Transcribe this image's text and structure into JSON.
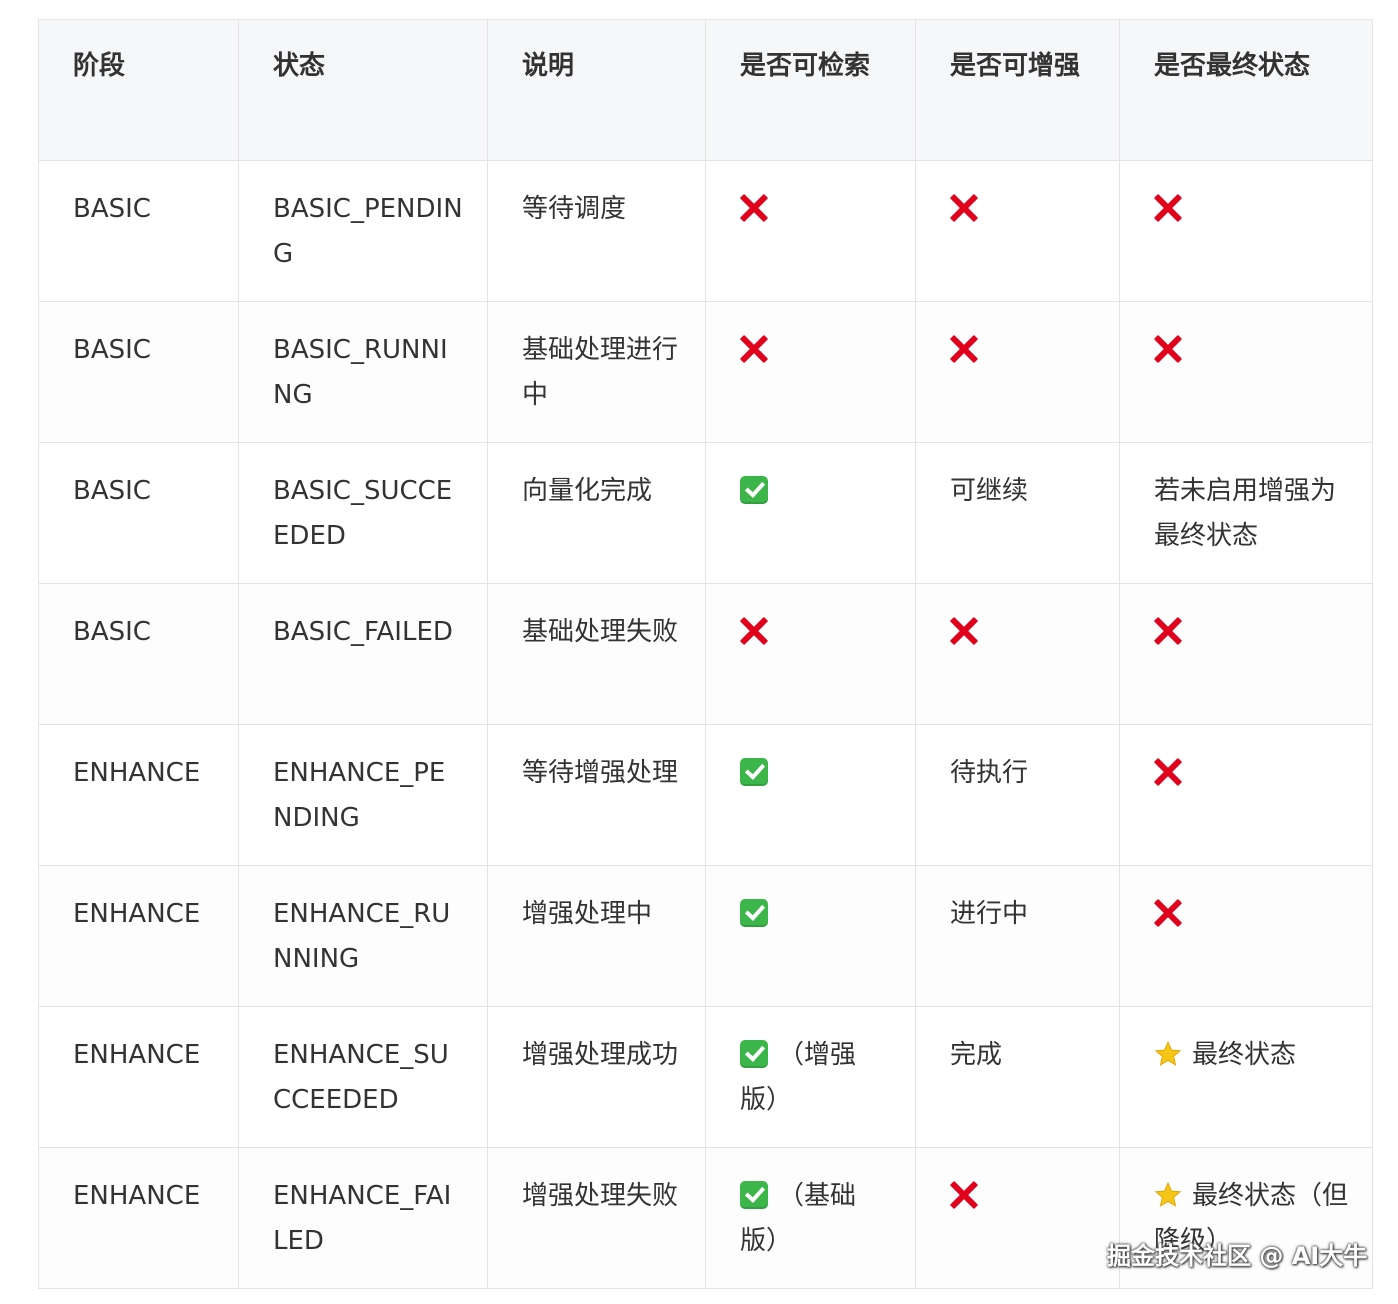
{
  "table": {
    "headers": [
      "阶段",
      "状态",
      "说明",
      "是否可检索",
      "是否可增强",
      "是否最终状态"
    ],
    "rows": [
      {
        "phase": "BASIC",
        "status": "BASIC_PENDING",
        "desc": "等待调度",
        "searchable": {
          "icon": "cross",
          "text": ""
        },
        "enhanceable": {
          "icon": "cross",
          "text": ""
        },
        "final": {
          "icon": "cross",
          "text": ""
        }
      },
      {
        "phase": "BASIC",
        "status": "BASIC_RUNNING",
        "desc": "基础处理进行中",
        "searchable": {
          "icon": "cross",
          "text": ""
        },
        "enhanceable": {
          "icon": "cross",
          "text": ""
        },
        "final": {
          "icon": "cross",
          "text": ""
        }
      },
      {
        "phase": "BASIC",
        "status": "BASIC_SUCCEEDED",
        "desc": "向量化完成",
        "searchable": {
          "icon": "check",
          "text": ""
        },
        "enhanceable": {
          "icon": "",
          "text": "可继续"
        },
        "final": {
          "icon": "",
          "text": "若未启用增强为最终状态"
        }
      },
      {
        "phase": "BASIC",
        "status": "BASIC_FAILED",
        "desc": "基础处理失败",
        "searchable": {
          "icon": "cross",
          "text": ""
        },
        "enhanceable": {
          "icon": "cross",
          "text": ""
        },
        "final": {
          "icon": "cross",
          "text": ""
        }
      },
      {
        "phase": "ENHANCE",
        "status": "ENHANCE_PENDING",
        "desc": "等待增强处理",
        "searchable": {
          "icon": "check",
          "text": ""
        },
        "enhanceable": {
          "icon": "",
          "text": "待执行"
        },
        "final": {
          "icon": "cross",
          "text": ""
        }
      },
      {
        "phase": "ENHANCE",
        "status": "ENHANCE_RUNNING",
        "desc": "增强处理中",
        "searchable": {
          "icon": "check",
          "text": ""
        },
        "enhanceable": {
          "icon": "",
          "text": "进行中"
        },
        "final": {
          "icon": "cross",
          "text": ""
        }
      },
      {
        "phase": "ENHANCE",
        "status": "ENHANCE_SUCCEEDED",
        "desc": "增强处理成功",
        "searchable": {
          "icon": "check",
          "text": "（增强版）"
        },
        "enhanceable": {
          "icon": "",
          "text": "完成"
        },
        "final": {
          "icon": "star",
          "text": "最终状态"
        }
      },
      {
        "phase": "ENHANCE",
        "status": "ENHANCE_FAILED",
        "desc": "增强处理失败",
        "searchable": {
          "icon": "check",
          "text": "（基础版）"
        },
        "enhanceable": {
          "icon": "cross",
          "text": ""
        },
        "final": {
          "icon": "star",
          "text": "最终状态（但降级）"
        }
      }
    ]
  },
  "icons": {
    "cross": "cross-mark-icon",
    "check": "check-mark-button-icon",
    "star": "star-icon"
  },
  "colors": {
    "cross": "#e0001b",
    "check": "#3cb64a",
    "star": "#f5c518",
    "header_bg": "#f6f7f8",
    "border": "#e3e3e3"
  },
  "watermark": "掘金技术社区 @ AI大牛"
}
